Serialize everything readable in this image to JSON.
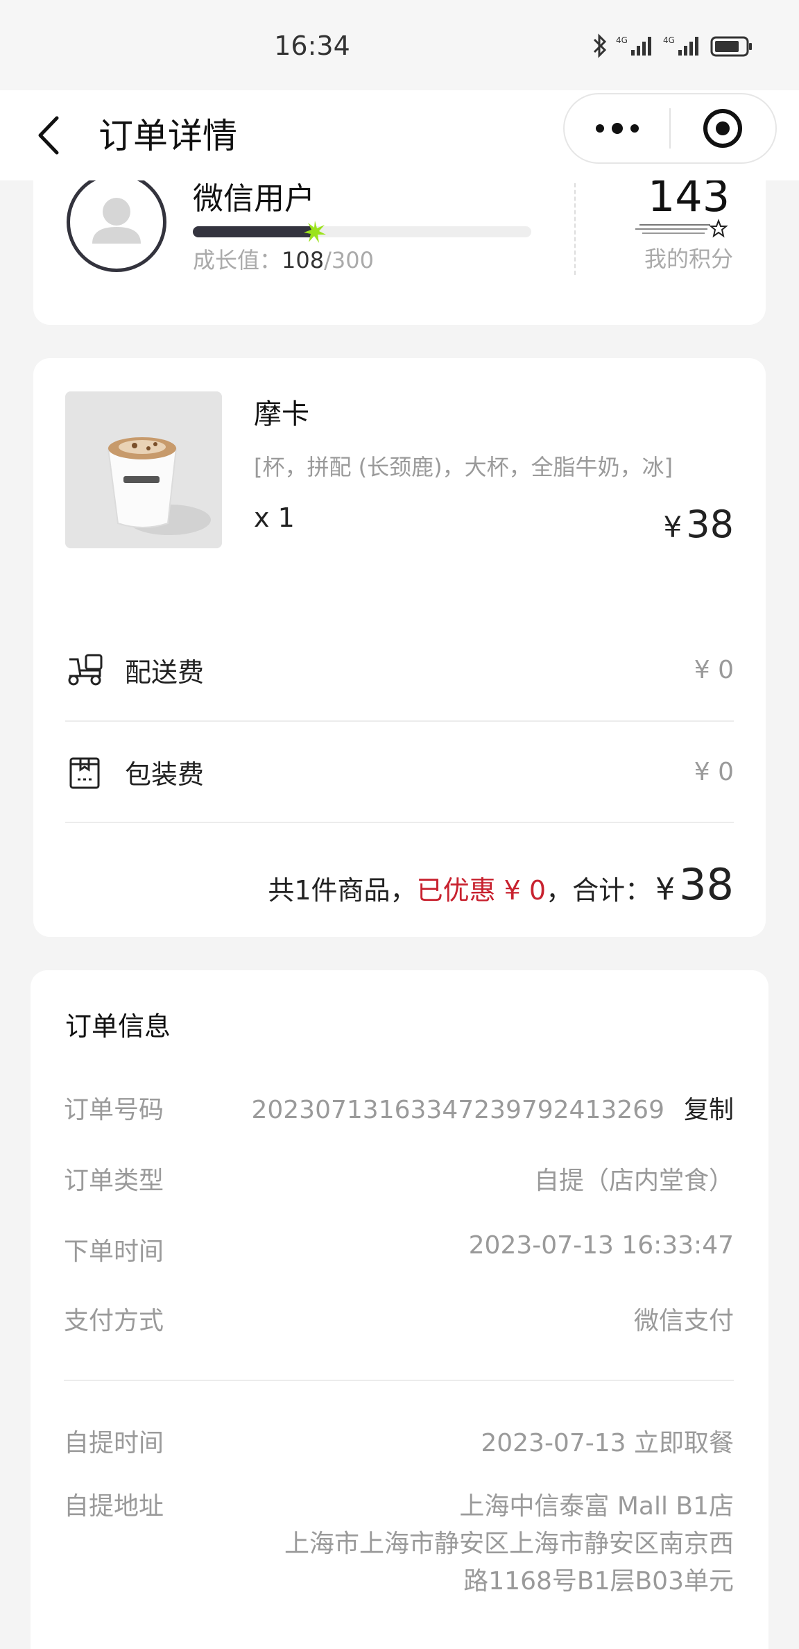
{
  "status_bar": {
    "time": "16:34",
    "icons": [
      "bluetooth-icon",
      "signal-4g-icon",
      "signal-4g-icon",
      "battery-icon"
    ]
  },
  "nav": {
    "title": "订单详情",
    "back_icon": "chevron-left-icon",
    "more_icon": "more-dots-icon",
    "close_icon": "target-circle-icon"
  },
  "member": {
    "name": "微信用户",
    "growth_label": "成长值：",
    "growth_current": "108",
    "growth_total": "/300",
    "growth_fraction": 0.36,
    "points_value": "143",
    "points_label": "我的积分"
  },
  "order": {
    "product": {
      "name": "摩卡",
      "spec": "[杯，拼配 (长颈鹿)，大杯，全脂牛奶，冰]",
      "qty": "x 1",
      "price_symbol": "¥",
      "price": "38"
    },
    "fees": [
      {
        "label": "配送费",
        "value": "¥ 0",
        "icon": "delivery-scooter-icon"
      },
      {
        "label": "包装费",
        "value": "¥ 0",
        "icon": "package-bag-icon"
      }
    ],
    "summary": {
      "count_text": "共1件商品，",
      "discount_text": "已优惠 ¥ 0",
      "total_label": "，合计：",
      "total_symbol": "¥",
      "total_value": "38"
    }
  },
  "info": {
    "title": "订单信息",
    "rows": [
      {
        "key": "订单号码",
        "value": "20230713163347239792413269",
        "action": "复制"
      },
      {
        "key": "订单类型",
        "value": "自提（店内堂食）"
      },
      {
        "key": "下单时间",
        "value": "2023-07-13 16:33:47"
      },
      {
        "key": "支付方式",
        "value": "微信支付"
      },
      {
        "key": "自提时间",
        "value": "2023-07-13 立即取餐"
      },
      {
        "key": "自提地址",
        "value_lines": [
          "上海中信泰富 Mall B1店",
          "上海市上海市静安区上海市静安区南京西",
          "路1168号B1层B03单元"
        ]
      }
    ]
  },
  "colors": {
    "accent_red": "#c8222f",
    "dark": "#34343f",
    "muted": "#9a9a9a",
    "spark": "#9be31b"
  }
}
